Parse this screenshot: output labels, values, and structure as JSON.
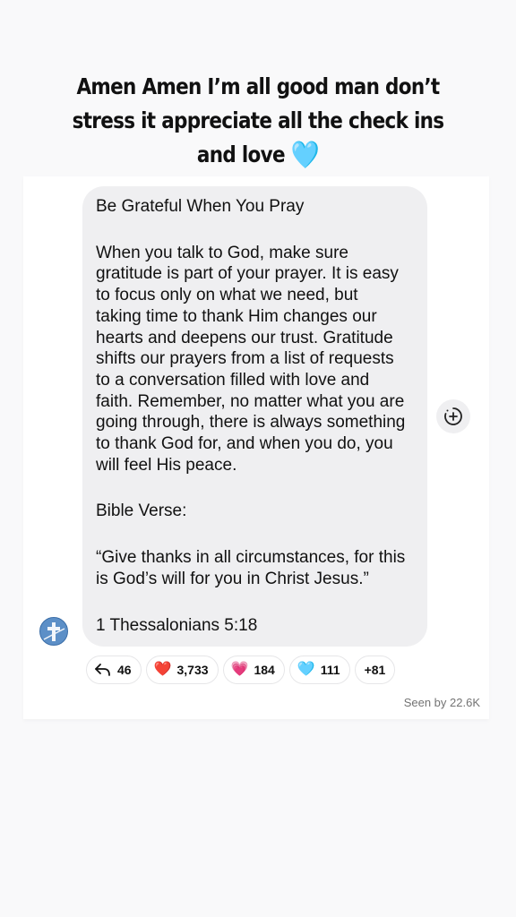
{
  "story": {
    "caption_text": "Amen Amen I’m all good man don’t\nstress it appreciate all the check ins\nand love",
    "caption_emoji": "🩵"
  },
  "message": {
    "paragraphs": [
      "Be Grateful When You Pray",
      "When you talk to God, make sure\ngratitude is part of your prayer. It is easy\nto focus only on what we need, but\ntaking time to thank Him changes our\nhearts and deepens our trust. Gratitude\nshifts our prayers from a list of requests\nto a conversation filled with love and\nfaith. Remember, no matter what you are\ngoing through, there is always something\nto thank God for, and when you do, you\nwill feel His peace.",
      "Bible Verse:",
      "“Give thanks in all circumstances, for this\nis God’s will for you in Christ Jesus.”",
      "1 Thessalonians 5:18"
    ]
  },
  "reactions": {
    "reply": {
      "icon": "reply-arrow-icon",
      "count": "46"
    },
    "red_heart": {
      "icon": "❤️",
      "count": "3,733"
    },
    "sparkling_heart": {
      "icon": "💗",
      "count": "184"
    },
    "light_blue_heart": {
      "icon": "🩵",
      "count": "111"
    },
    "more": {
      "label": "+81"
    }
  },
  "seen_by": "Seen by 22.6K",
  "colors": {
    "background": "#f9f9fa",
    "bubble": "#efeff1",
    "avatar": "#5c8fc7",
    "red_heart": "#e0152b",
    "pink_heart": "#e64bb0",
    "blue_heart": "#6fd0ee"
  }
}
